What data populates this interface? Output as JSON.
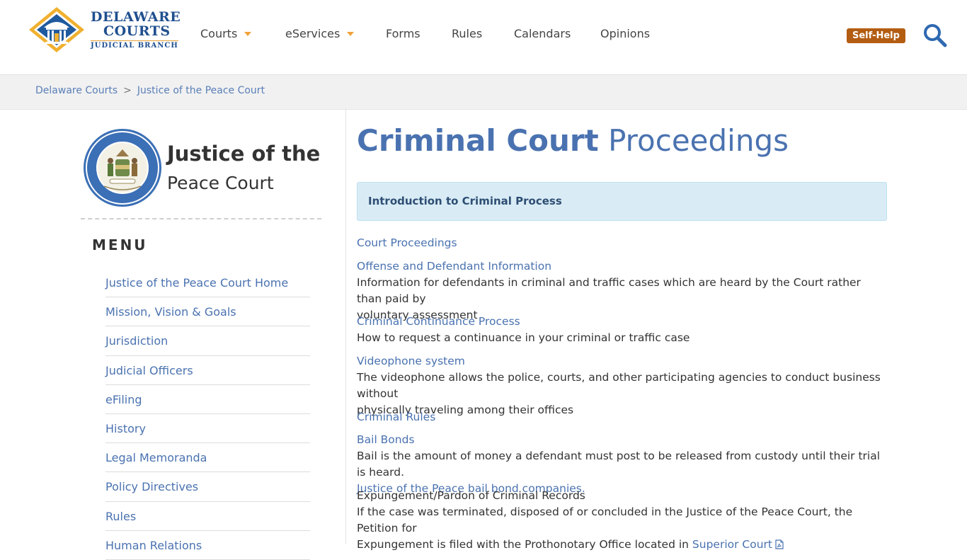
{
  "header": {
    "logo": {
      "line1": "DELAWARE",
      "line2": "COURTS",
      "line3": "JUDICIAL BRANCH"
    },
    "nav": [
      {
        "label": "Courts",
        "dropdown": true
      },
      {
        "label": "eServices",
        "dropdown": true
      },
      {
        "label": "Forms",
        "dropdown": false
      },
      {
        "label": "Rules",
        "dropdown": false
      },
      {
        "label": "Calendars",
        "dropdown": false
      },
      {
        "label": "Opinions",
        "dropdown": false
      }
    ],
    "self_help": "Self-Help",
    "search_icon": "search-icon"
  },
  "breadcrumb": {
    "items": [
      "Delaware Courts",
      "Justice of the Peace Court"
    ],
    "separator": ">"
  },
  "sidebar": {
    "court_title_line1": "Justice of the",
    "court_title_line2": "Peace Court",
    "menu_heading": "MENU",
    "menu_items": [
      "Justice of the Peace Court Home",
      "Mission, Vision & Goals",
      "Jurisdiction",
      "Judicial Officers",
      "eFiling",
      "History",
      "Legal Memoranda",
      "Policy Directives",
      "Rules",
      "Human Relations"
    ]
  },
  "main": {
    "title_bold": "Criminal Court",
    "title_rest": "Proceedings",
    "intro_box": "Introduction to Criminal Process",
    "sections": {
      "court_proceedings": "Court Proceedings",
      "offense_link": "Offense and Defendant Information",
      "offense_desc_1": "Information for defendants in criminal and traffic cases which are heard by the Court rather than paid by",
      "offense_desc_2": "voluntary assessment",
      "continuance_link": "Criminal Continuance Process",
      "continuance_desc": "How to request a continuance in your criminal or traffic case",
      "videophone_link": "Videophone system",
      "videophone_desc_1": "The videophone allows the police, courts, and other participating agencies to conduct business without",
      "videophone_desc_2": "physically traveling among their offices",
      "rules_link": "Criminal Rules",
      "bail_link": "Bail Bonds",
      "bail_desc": "Bail is the amount of money a defendant must post to be released from custody until their trial is heard.",
      "bail_companies_link": "Justice of the Peace bail bond companies.",
      "expungement_head": "Expungement/Pardon of Criminal Records",
      "expungement_desc_1": "If the case was terminated, disposed of or concluded in the Justice of the Peace Court, the Petition for",
      "expungement_desc_2": "Expungement is filed with the Prothonotary Office located in",
      "superior_court_link": "Superior Court"
    }
  },
  "colors": {
    "link": "#4a72b0",
    "accent": "#f0a23a",
    "self_help_bg": "#b35d12",
    "intro_bg": "#d9ecf6"
  }
}
